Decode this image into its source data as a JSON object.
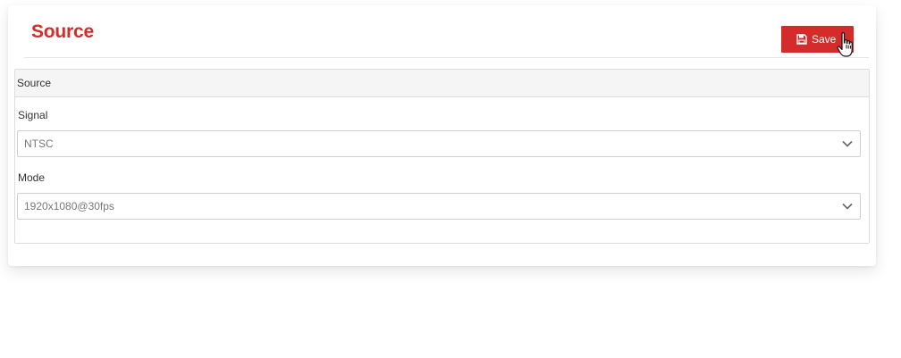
{
  "header": {
    "title": "Source",
    "save_label": "Save"
  },
  "panel": {
    "heading": "Source",
    "fields": [
      {
        "label": "Signal",
        "value": "NTSC"
      },
      {
        "label": "Mode",
        "value": "1920x1080@30fps"
      }
    ]
  },
  "icons": {
    "save": "floppy-disk-icon",
    "dropdown": "chevron-down-icon",
    "cursor": "hand-pointer-cursor"
  },
  "colors": {
    "accent": "#d42b2b",
    "panel_heading_bg": "#f5f5f5",
    "border": "#dcdcdc"
  }
}
